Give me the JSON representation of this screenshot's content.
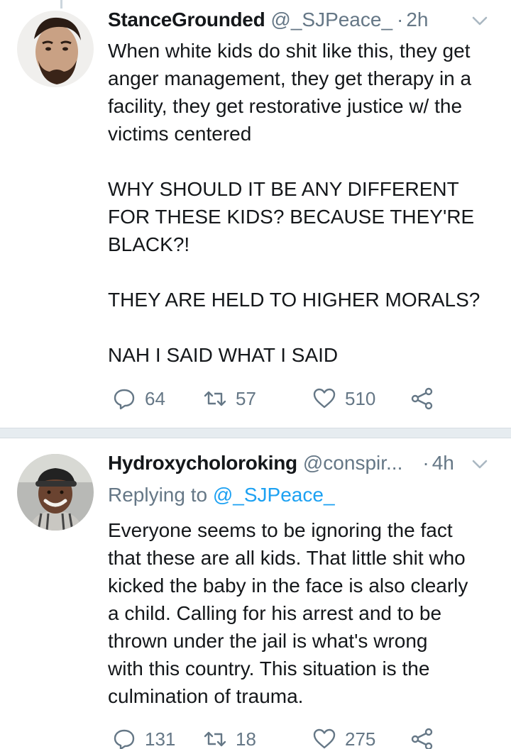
{
  "tweets": [
    {
      "display_name": "StanceGrounded",
      "handle": "@_SJPeace_",
      "separator": "·",
      "time": "2h",
      "lines": [
        "When white kids do shit like this, they get",
        "anger management, they get therapy in a",
        "facility, they get restorative justice w/ the",
        "victims centered",
        "",
        "WHY SHOULD IT BE ANY DIFFERENT",
        "FOR THESE KIDS? BECAUSE THEY'RE",
        "BLACK?!",
        "",
        "THEY ARE HELD TO HIGHER MORALS?",
        "",
        "NAH I SAID WHAT I SAID"
      ],
      "replies": "64",
      "retweets": "57",
      "likes": "510"
    },
    {
      "display_name": "Hydroxycholoroking",
      "handle": "@conspir...",
      "separator": "·",
      "time": "4h",
      "replying_prefix": "Replying to",
      "replying_to": "@_SJPeace_",
      "lines": [
        "Everyone seems to be ignoring the fact",
        "that these are all kids. That little shit who",
        "kicked the baby in the face is also clearly",
        "a child. Calling for his arrest and to be",
        "thrown under the jail is what's wrong",
        "with this country. This situation is the",
        "culmination of trauma."
      ],
      "replies": "131",
      "retweets": "18",
      "likes": "275"
    }
  ],
  "icons": {
    "reply": "reply-icon",
    "retweet": "retweet-icon",
    "like": "heart-icon",
    "share": "share-icon",
    "caret": "chevron-down-icon"
  },
  "colors": {
    "text": "#14171a",
    "secondary": "#657786",
    "link": "#1da1f2",
    "separator": "#e6ecf0"
  }
}
